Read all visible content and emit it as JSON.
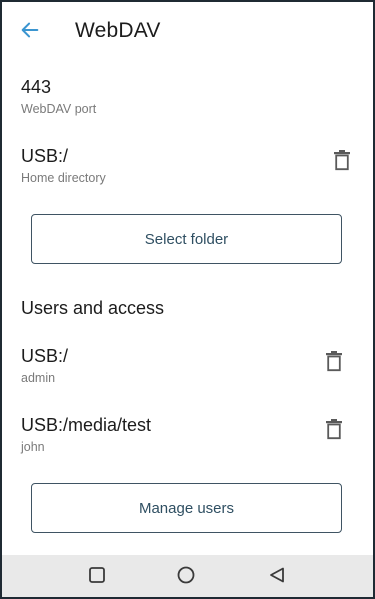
{
  "appbar": {
    "title": "WebDAV",
    "back_icon": "arrow-left-icon",
    "accent_color": "#3b95d0"
  },
  "settings": {
    "port": {
      "value": "443",
      "label": "WebDAV port"
    },
    "home": {
      "value": "USB:/",
      "label": "Home directory",
      "icon": "trash-icon"
    }
  },
  "select_folder_button": "Select folder",
  "users_section": {
    "header": "Users and access",
    "users": [
      {
        "path": "USB:/",
        "user": "admin",
        "icon": "trash-icon"
      },
      {
        "path": "USB:/media/test",
        "user": "john",
        "icon": "trash-icon"
      }
    ],
    "manage_button": "Manage users"
  },
  "navbar": {
    "icons": [
      "square-recents-icon",
      "circle-home-icon",
      "triangle-back-icon"
    ]
  }
}
